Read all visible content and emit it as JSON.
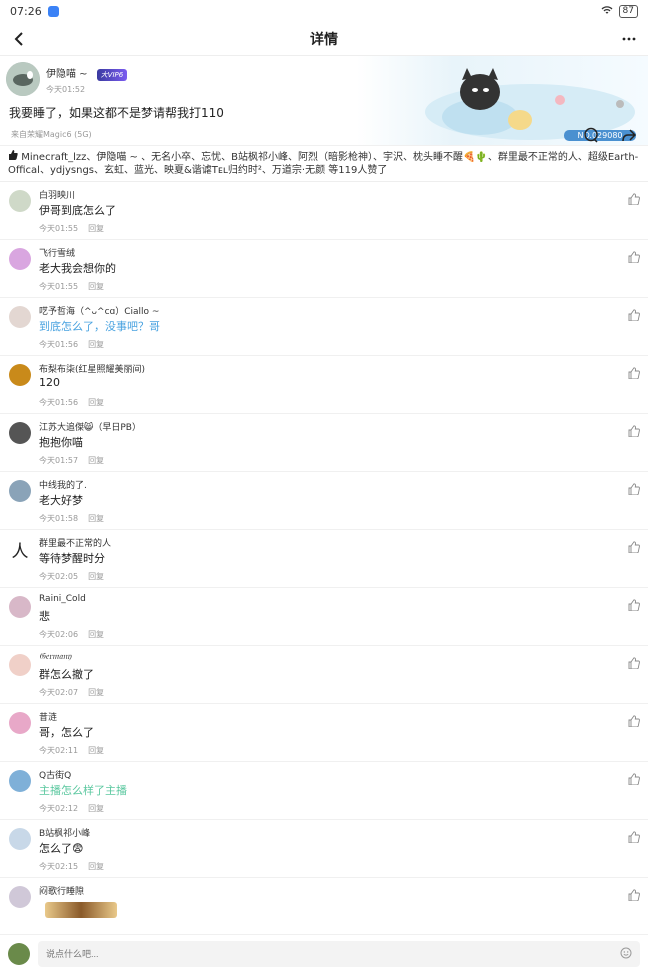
{
  "status": {
    "time": "07:26",
    "battery": "87"
  },
  "header": {
    "title": "详情"
  },
  "post": {
    "author": "伊隐喵 ~",
    "vip": "大VIP6",
    "time": "今天01:52",
    "content": "我要睡了，如果这都不是梦请帮我打110",
    "device": "来自荣耀Magic6 (5G)",
    "badge": "NO.029080"
  },
  "likes": "Minecraft_lzz、伊隐喵 ~ 、无名小卒、忘忧、B站枫祁小峰、阿烈（暗影枪神）、宇沢、枕头睡不醒🍕🌵、群里最不正常的人、超级Earth-Offical、ydjysngs、玄虹、蓝光、映夏&谐谑Tᴇʟ归约时²、万道宗·无颜 等119人赞了",
  "comments": [
    {
      "nick": "白羽映川",
      "text": "伊哥到底怎么了",
      "time": "今天01:55",
      "reply": "回复",
      "color": "#cfd9c8"
    },
    {
      "nick": "飞行雪绒",
      "text": "老大我会想你的",
      "time": "今天01:55",
      "reply": "回复",
      "color": "#d9a6e0"
    },
    {
      "nick": "呓予哲海（^ᴗ^ᴄɑ）Ciallo ~",
      "text": "到底怎么了，没事吧？哥",
      "time": "今天01:56",
      "reply": "回复",
      "color": "#e3d7d2"
    },
    {
      "nick": "布梨布柒(红星照耀美丽间)",
      "text": "120",
      "time": "今天01:56",
      "reply": "回复",
      "color": "#c98a1a"
    },
    {
      "nick": "江苏大追傑😸（早日PB）",
      "text": "抱抱你喵",
      "time": "今天01:57",
      "reply": "回复",
      "color": "#555"
    },
    {
      "nick": "中线我的了.",
      "text": "老大好梦",
      "time": "今天01:58",
      "reply": "回复",
      "color": "#8aa3b8"
    },
    {
      "nick": "群里最不正常的人",
      "text": "等待梦醒时分",
      "time": "今天02:05",
      "reply": "回复",
      "color": "#ffffff"
    },
    {
      "nick": "Raini_Cold",
      "text": "悲",
      "time": "今天02:06",
      "reply": "回复",
      "color": "#d8b8c8"
    },
    {
      "nick": "𝔊𝔢𝔯𝔪𝔞𝔫𝔶",
      "text": "群怎么撤了",
      "time": "今天02:07",
      "reply": "回复",
      "color": "#f0d0c8"
    },
    {
      "nick": "昔涟",
      "text": "哥，怎么了",
      "time": "今天02:11",
      "reply": "回复",
      "color": "#e8a8c8"
    },
    {
      "nick": "Q古街Q",
      "text": "主播怎么样了主播",
      "time": "今天02:12",
      "reply": "回复",
      "color": "#7fb0d8"
    },
    {
      "nick": "B站枫祁小峰",
      "text": "怎么了😨",
      "time": "今天02:15",
      "reply": "回复",
      "color": "#c8d8e8"
    },
    {
      "nick": "闷歌行睡隙",
      "text": "",
      "time": "",
      "reply": "",
      "color": "#d0c8d8"
    }
  ],
  "input": {
    "placeholder": "说点什么吧..."
  }
}
